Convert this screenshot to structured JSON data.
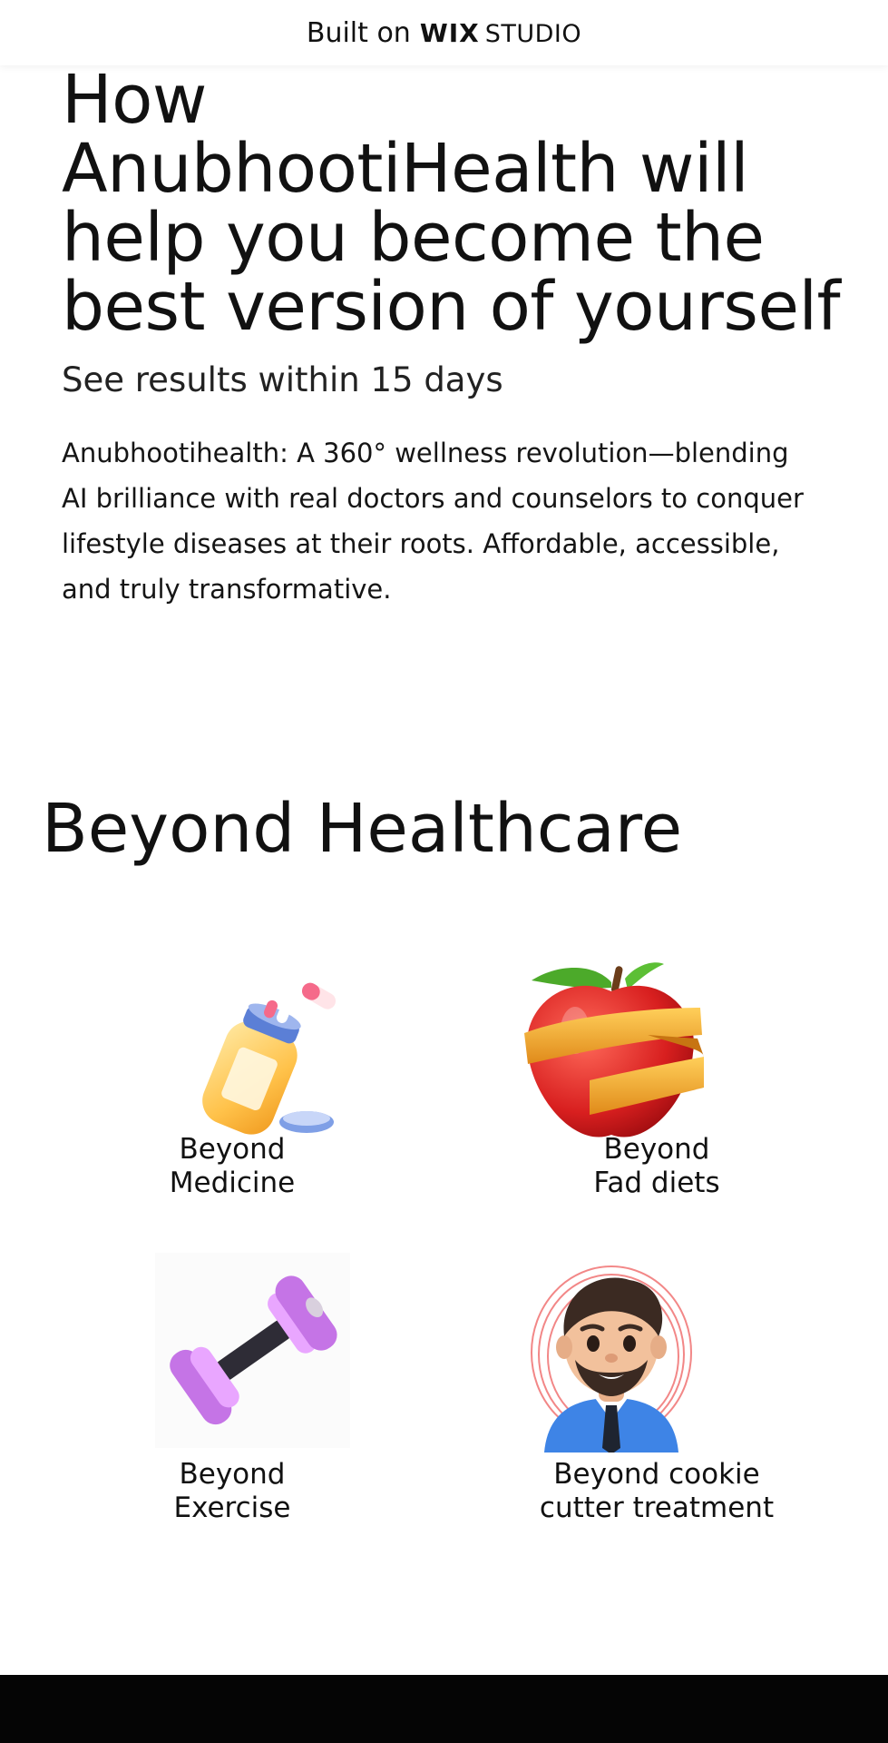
{
  "banner": {
    "prefix": "Built on",
    "wix": "WIX",
    "studio": "STUDIO"
  },
  "hero": {
    "title_lines": [
      "How",
      "AnubhootiHealth will",
      "help you become the",
      "best version of yourself"
    ],
    "subtitle": "See results within 15 days",
    "body_lines": [
      "Anubhootihealth: A 360° wellness revolution—blending",
      "AI brilliance with real doctors and counselors to conquer",
      "lifestyle diseases at their roots. Affordable, accessible,",
      "and truly transformative."
    ]
  },
  "section": {
    "title": "Beyond Healthcare"
  },
  "features": [
    {
      "icon": "medicine-bottle-icon",
      "label_lines": [
        "Beyond",
        "Medicine"
      ]
    },
    {
      "icon": "apple-measuring-tape-icon",
      "label_lines": [
        "Beyond",
        "Fad diets"
      ]
    },
    {
      "icon": "dumbbell-icon",
      "label_lines": [
        "Beyond",
        "Exercise"
      ]
    },
    {
      "icon": "doctor-avatar-icon",
      "label_lines": [
        "Beyond cookie",
        "cutter treatment"
      ]
    }
  ],
  "colors": {
    "background": "#ffffff",
    "text": "#111111",
    "footer": "#050505"
  }
}
